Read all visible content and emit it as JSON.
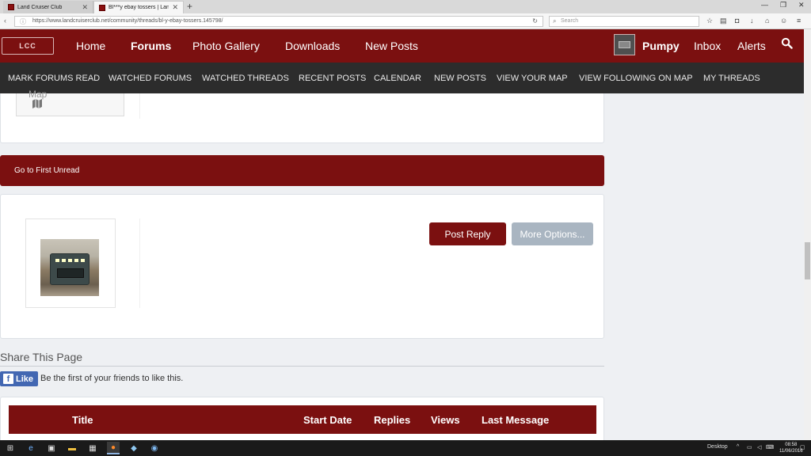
{
  "browser": {
    "tabs": [
      {
        "label": "Land Cruiser Club"
      },
      {
        "label": "Bl***y ebay tossers | Land ..."
      }
    ],
    "url": "https://www.landcruiserclub.net/community/threads/bl-y-ebay-tossers.145798/",
    "search_placeholder": "Search"
  },
  "header": {
    "logo_text": "LCC",
    "nav": [
      "Home",
      "Forums",
      "Photo Gallery",
      "Downloads",
      "New Posts"
    ],
    "active_nav": "Forums",
    "user": "Pumpy",
    "inbox": "Inbox",
    "alerts": "Alerts"
  },
  "subnav": [
    "MARK FORUMS READ",
    "WATCHED FORUMS",
    "WATCHED THREADS",
    "RECENT POSTS",
    "CALENDAR",
    "NEW POSTS",
    "VIEW YOUR MAP",
    "VIEW FOLLOWING ON MAP",
    "MY THREADS"
  ],
  "content": {
    "map_label": "Map",
    "first_unread": "Go to First Unread",
    "post_reply": "Post Reply",
    "more_options": "More Options...",
    "share_title": "Share This Page",
    "like_label": "Like",
    "like_text": "Be the first of your friends to like this.",
    "table_headers": [
      "Title",
      "Start Date",
      "Replies",
      "Views",
      "Last Message"
    ]
  },
  "taskbar": {
    "desktop_label": "Desktop",
    "time": "08:58",
    "date": "11/06/2016"
  },
  "colors": {
    "brand": "#7b1010",
    "subnav_bg": "#2c2c2c",
    "facebook": "#4267b2"
  }
}
